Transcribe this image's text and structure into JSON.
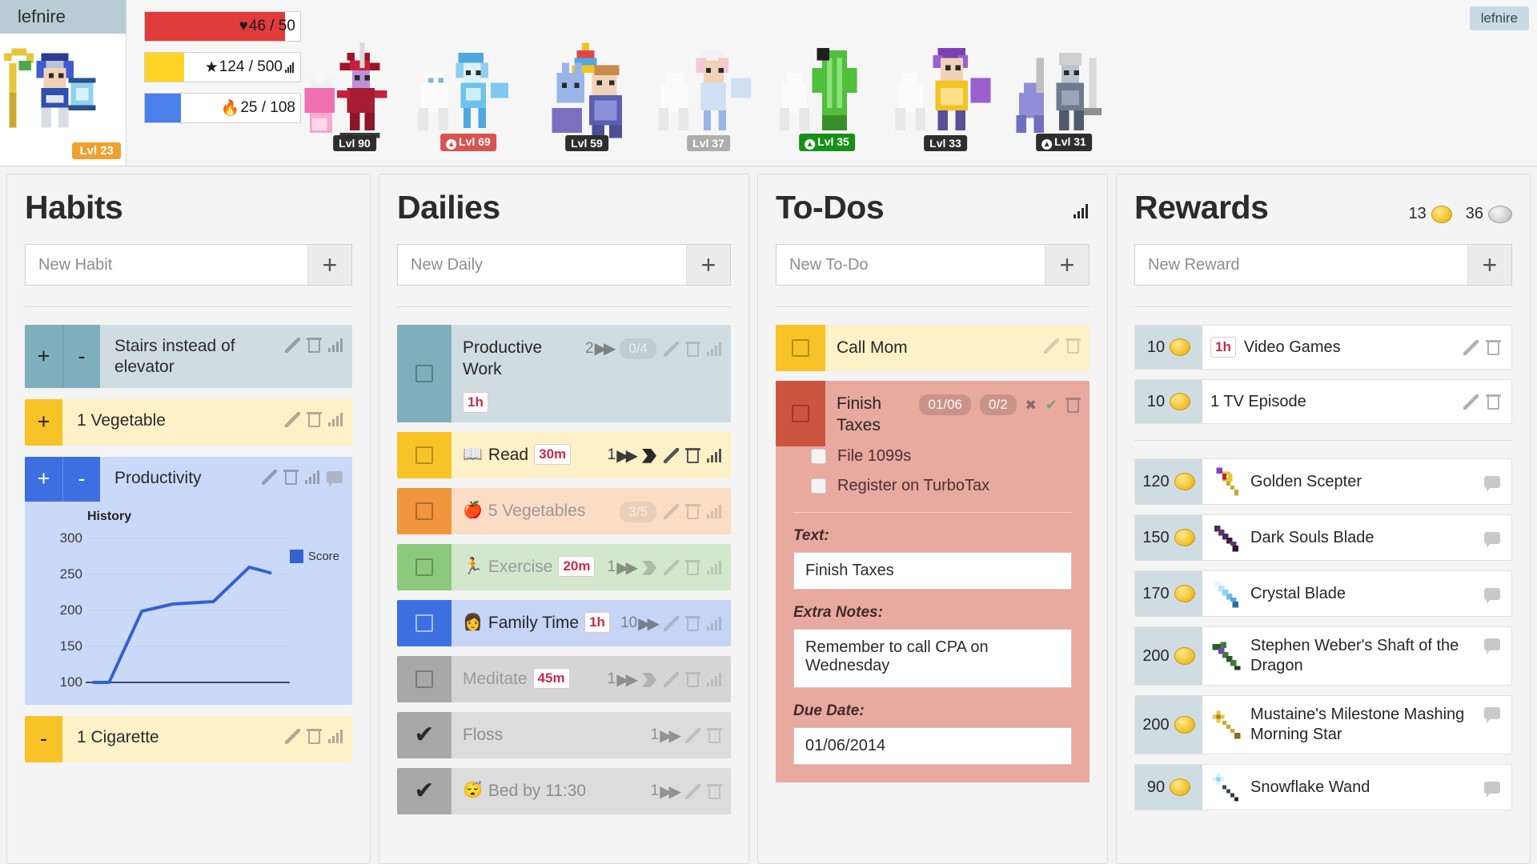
{
  "header": {
    "username": "lefnire",
    "top_right_username": "lefnire",
    "avatar_level": "Lvl 23",
    "stats": [
      {
        "name": "health",
        "icon": "heart-icon",
        "glyph": "♥",
        "value": "46 / 50",
        "pct": 90,
        "color": "#e03c3c"
      },
      {
        "name": "experience",
        "icon": "star-icon",
        "glyph": "★",
        "value": "124 / 500",
        "pct": 25,
        "color": "#ffd324"
      },
      {
        "name": "mana",
        "icon": "flame-icon",
        "glyph": "🔥",
        "value": "25 / 108",
        "pct": 23,
        "color": "#4a7fec"
      }
    ],
    "party": [
      {
        "level": "Lvl 90",
        "style": "dark",
        "arrow": false
      },
      {
        "level": "Lvl 69",
        "style": "red",
        "arrow": true
      },
      {
        "level": "Lvl 59",
        "style": "dark",
        "arrow": false
      },
      {
        "level": "Lvl 37",
        "style": "gray",
        "arrow": false
      },
      {
        "level": "Lvl 35",
        "style": "green",
        "arrow": true
      },
      {
        "level": "Lvl 33",
        "style": "dark",
        "arrow": false
      },
      {
        "level": "Lvl 31",
        "style": "dark",
        "arrow": true
      }
    ]
  },
  "habits": {
    "title": "Habits",
    "new_placeholder": "New Habit",
    "add_label": "+",
    "items": [
      {
        "title": "Stairs instead of elevator",
        "plus": "+",
        "minus": "-",
        "has_plus": true,
        "has_minus": true,
        "bg": "#cfdde3",
        "btn": "#7fafbd",
        "icons": [
          "pencil-icon",
          "trash-icon",
          "chart-icon"
        ]
      },
      {
        "title": "1 Vegetable",
        "plus": "+",
        "minus": "",
        "has_plus": true,
        "has_minus": false,
        "bg": "#fdf1c7",
        "btn": "#f7c326",
        "icons": [
          "pencil-icon",
          "trash-icon",
          "chart-icon"
        ]
      },
      {
        "title": "Productivity",
        "plus": "+",
        "minus": "-",
        "has_plus": true,
        "has_minus": true,
        "bg": "#cad9f7",
        "btn": "#3d6fe0",
        "icons": [
          "pencil-icon",
          "trash-icon",
          "chart-icon",
          "comment-icon"
        ],
        "expanded": true
      },
      {
        "title": "1 Cigarette",
        "plus": "",
        "minus": "-",
        "has_plus": false,
        "has_minus": true,
        "bg": "#fdf1c7",
        "btn": "#f7c326",
        "icons": [
          "pencil-icon",
          "trash-icon",
          "chart-icon"
        ]
      }
    ]
  },
  "chart_data": {
    "type": "line",
    "title": "History",
    "legend": [
      "Score"
    ],
    "legend_position": "right",
    "xlabel": "",
    "ylabel": "",
    "ylim": [
      100,
      300
    ],
    "yticks": [
      100,
      150,
      200,
      250,
      300
    ],
    "grid": true,
    "series": [
      {
        "name": "Score",
        "color": "#3362cf",
        "x": [
          0,
          1,
          2,
          3,
          4,
          5,
          6
        ],
        "values": [
          100,
          100,
          205,
          215,
          217,
          260,
          253
        ]
      }
    ]
  },
  "dailies": {
    "title": "Dailies",
    "new_placeholder": "New Daily",
    "add_label": "+",
    "items": [
      {
        "title": "Productive Work",
        "emoji": "",
        "time_tag": "1h",
        "streak": "2",
        "pill": "0/4",
        "bg": "#cfdde3",
        "check": "#7fafbd",
        "checked": false,
        "state": "normal",
        "icons": [
          "pencil-icon",
          "trash-icon",
          "chart-icon"
        ]
      },
      {
        "title": "Read",
        "emoji": "📖",
        "time_tag": "30m",
        "streak": "1",
        "pill": "",
        "bg": "#fdf1c7",
        "check": "#f7c326",
        "checked": false,
        "state": "normal",
        "icons": [
          "tag-icon",
          "pencil-icon",
          "trash-icon",
          "chart-icon"
        ]
      },
      {
        "title": "5 Vegetables",
        "emoji": "🍎",
        "time_tag": "",
        "streak": "",
        "pill": "3/5",
        "bg": "#fbdcc4",
        "check": "#f0963c",
        "checked": false,
        "state": "dim",
        "icons": [
          "pencil-icon",
          "trash-icon",
          "chart-icon"
        ]
      },
      {
        "title": "Exercise",
        "emoji": "🏃",
        "time_tag": "20m",
        "streak": "1",
        "pill": "",
        "bg": "#d3e7cd",
        "check": "#8cc97c",
        "checked": false,
        "state": "dim",
        "icons": [
          "tag-icon",
          "pencil-icon",
          "trash-icon",
          "chart-icon"
        ]
      },
      {
        "title": "Family Time",
        "emoji": "👩",
        "time_tag": "1h",
        "streak": "10",
        "pill": "",
        "bg": "#c6d4f5",
        "check": "#3d6fe0",
        "checked": false,
        "state": "normal",
        "icons": [
          "pencil-icon",
          "trash-icon",
          "chart-icon"
        ]
      },
      {
        "title": "Meditate",
        "emoji": "",
        "time_tag": "45m",
        "streak": "1",
        "pill": "",
        "bg": "#d5d5d5",
        "check": "#a8a8a8",
        "checked": false,
        "state": "dim",
        "icons": [
          "tag-icon",
          "pencil-icon",
          "trash-icon",
          "chart-icon"
        ]
      },
      {
        "title": "Floss",
        "emoji": "",
        "time_tag": "",
        "streak": "1",
        "pill": "",
        "bg": "#dcdcdc",
        "check": "#a8a8a8",
        "checked": true,
        "state": "done",
        "icons": [
          "pencil-icon",
          "trash-icon"
        ]
      },
      {
        "title": "Bed by 11:30",
        "emoji": "😴",
        "time_tag": "",
        "streak": "1",
        "pill": "",
        "bg": "#dcdcdc",
        "check": "#a8a8a8",
        "checked": true,
        "state": "done",
        "icons": [
          "pencil-icon",
          "trash-icon"
        ]
      }
    ]
  },
  "todos": {
    "title": "To-Dos",
    "new_placeholder": "New To-Do",
    "add_label": "+",
    "chart_icon": "chart-icon",
    "items": [
      {
        "title": "Call Mom",
        "bg": "#fdf1c7",
        "check": "#f7c326",
        "date": "",
        "pill": "",
        "icons": [
          "pencil-icon",
          "trash-icon"
        ]
      },
      {
        "title": "Finish Taxes",
        "bg": "#e8a99f",
        "check": "#cc5540",
        "date": "01/06",
        "pill": "0/2",
        "icons": [
          "close-icon",
          "check-icon",
          "trash-icon"
        ]
      }
    ],
    "detail": {
      "subtasks": [
        {
          "label": "File 1099s",
          "checked": false
        },
        {
          "label": "Register on TurboTax",
          "checked": false
        }
      ],
      "text_label": "Text:",
      "text_value": "Finish Taxes",
      "notes_label": "Extra Notes:",
      "notes_value": "Remember to call CPA on Wednesday",
      "due_label": "Due Date:",
      "due_value": "01/06/2014"
    }
  },
  "rewards": {
    "title": "Rewards",
    "new_placeholder": "New Reward",
    "add_label": "+",
    "gold": "13",
    "gems": "36",
    "custom": [
      {
        "cost": "10",
        "name": "Video Games",
        "time_tag": "1h",
        "icons": [
          "pencil-icon",
          "trash-icon"
        ]
      },
      {
        "cost": "10",
        "name": "1 TV Episode",
        "time_tag": "",
        "icons": [
          "pencil-icon",
          "trash-icon"
        ]
      }
    ],
    "equipment": [
      {
        "cost": "120",
        "name": "Golden Scepter",
        "item": "scepter",
        "icons": [
          "comment-icon"
        ]
      },
      {
        "cost": "150",
        "name": "Dark Souls Blade",
        "item": "dark-blade",
        "icons": [
          "comment-icon"
        ]
      },
      {
        "cost": "170",
        "name": "Crystal Blade",
        "item": "crystal-blade",
        "icons": [
          "comment-icon"
        ]
      },
      {
        "cost": "200",
        "name": "Stephen Weber's Shaft of the Dragon",
        "item": "dragon-staff",
        "icons": [
          "comment-icon"
        ]
      },
      {
        "cost": "200",
        "name": "Mustaine's Milestone Mashing Morning Star",
        "item": "morning-star",
        "icons": [
          "comment-icon"
        ]
      },
      {
        "cost": "90",
        "name": "Snowflake Wand",
        "item": "snowflake-wand",
        "icons": [
          "comment-icon"
        ]
      }
    ]
  }
}
